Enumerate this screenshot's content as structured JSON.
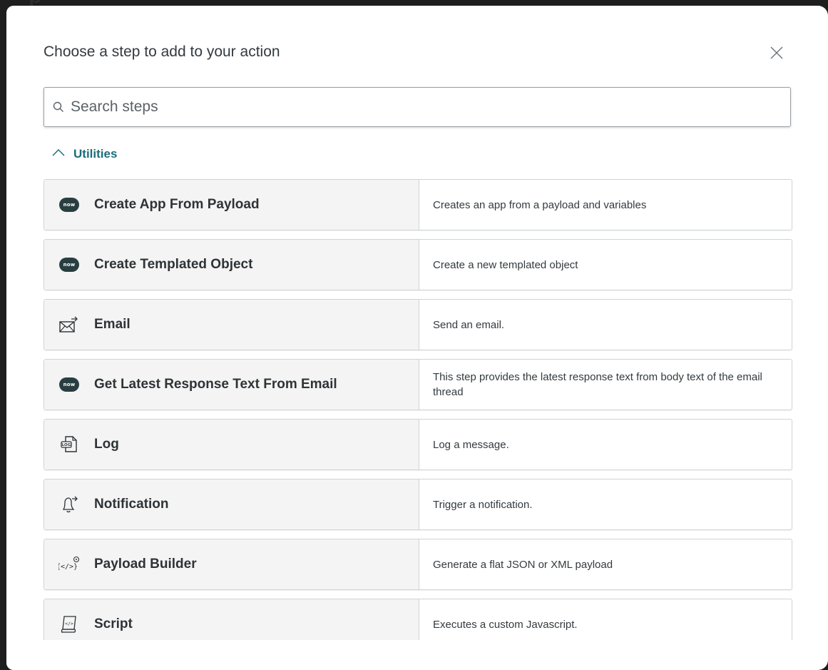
{
  "background": {
    "title_fragment": "p"
  },
  "modal": {
    "title": "Choose a step to add to your action",
    "close_icon": "close-icon"
  },
  "search": {
    "placeholder": "Search steps",
    "value": "",
    "icon": "search-icon"
  },
  "section": {
    "label": "Utilities",
    "expanded": true,
    "icon": "chevron-up-icon"
  },
  "colors": {
    "accent": "#1a6e7a",
    "now_badge": "#293e40",
    "row_left_bg": "#f4f4f4",
    "border": "#cfd3d5"
  },
  "steps": [
    {
      "name": "Create App From Payload",
      "description": "Creates an app from a payload and variables",
      "icon": "now-icon",
      "badge_text": "now"
    },
    {
      "name": "Create Templated Object",
      "description": "Create a new templated object",
      "icon": "now-icon",
      "badge_text": "now"
    },
    {
      "name": "Email",
      "description": "Send an email.",
      "icon": "email-icon"
    },
    {
      "name": "Get Latest Response Text From Email",
      "description": "This step provides the latest response text from body text of the email thread",
      "icon": "now-icon",
      "badge_text": "now"
    },
    {
      "name": "Log",
      "description": "Log a message.",
      "icon": "log-icon",
      "badge_text": "LOG"
    },
    {
      "name": "Notification",
      "description": "Trigger a notification.",
      "icon": "notification-icon"
    },
    {
      "name": "Payload Builder",
      "description": "Generate a flat JSON or XML payload",
      "icon": "payload-builder-icon",
      "badge_text": "{</>}"
    },
    {
      "name": "Script",
      "description": "Executes a custom Javascript.",
      "icon": "script-icon",
      "badge_text": "</>"
    }
  ]
}
